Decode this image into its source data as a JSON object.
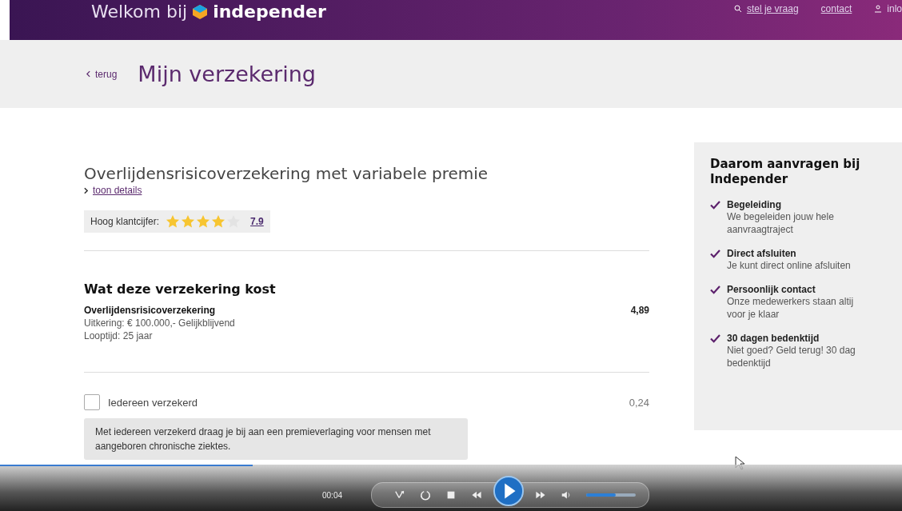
{
  "header": {
    "welcome": "Welkom bij",
    "brand": "independer",
    "links": [
      "stel je vraag",
      "contact"
    ],
    "login": "inlo"
  },
  "subheader": {
    "back": "terug",
    "title": "Mijn verzekering"
  },
  "product": {
    "title": "Overlijdensrisicoverzekering met variabele premie",
    "details_link": "toon details",
    "rating_label": "Hoog klantcijfer:",
    "stars": 4,
    "score": "7.9"
  },
  "costs": {
    "heading": "Wat deze verzekering kost",
    "name": "Overlijdensrisicoverzekering",
    "price": "4,89",
    "lines": [
      "Uitkering: € 100.000,- Gelijkblijvend",
      "Looptijd: 25 jaar"
    ]
  },
  "option": {
    "label": "Iedereen verzekerd",
    "checked": false,
    "price": "0,24",
    "tooltip": "Met iedereen verzekerd draag je bij aan een premieverlaging voor mensen met aangeboren chronische ziektes."
  },
  "sidebar": {
    "title": "Daarom aanvragen bij Independer",
    "items": [
      {
        "title": "Begeleiding",
        "lines": [
          "We begeleiden jouw hele",
          "aanvraagtraject"
        ]
      },
      {
        "title": "Direct afsluiten",
        "lines": [
          "Je kunt direct online afsluiten"
        ]
      },
      {
        "title": "Persoonlijk contact",
        "lines": [
          "Onze medewerkers staan altij",
          "voor je klaar"
        ]
      },
      {
        "title": "30 dagen bedenktijd",
        "lines": [
          "Niet goed? Geld terug! 30 dag",
          "bedenktijd"
        ]
      }
    ]
  },
  "player": {
    "time": "00:04",
    "progress": {
      "level": 0.28
    },
    "volume": {
      "level": 0.6
    },
    "playing": false
  }
}
